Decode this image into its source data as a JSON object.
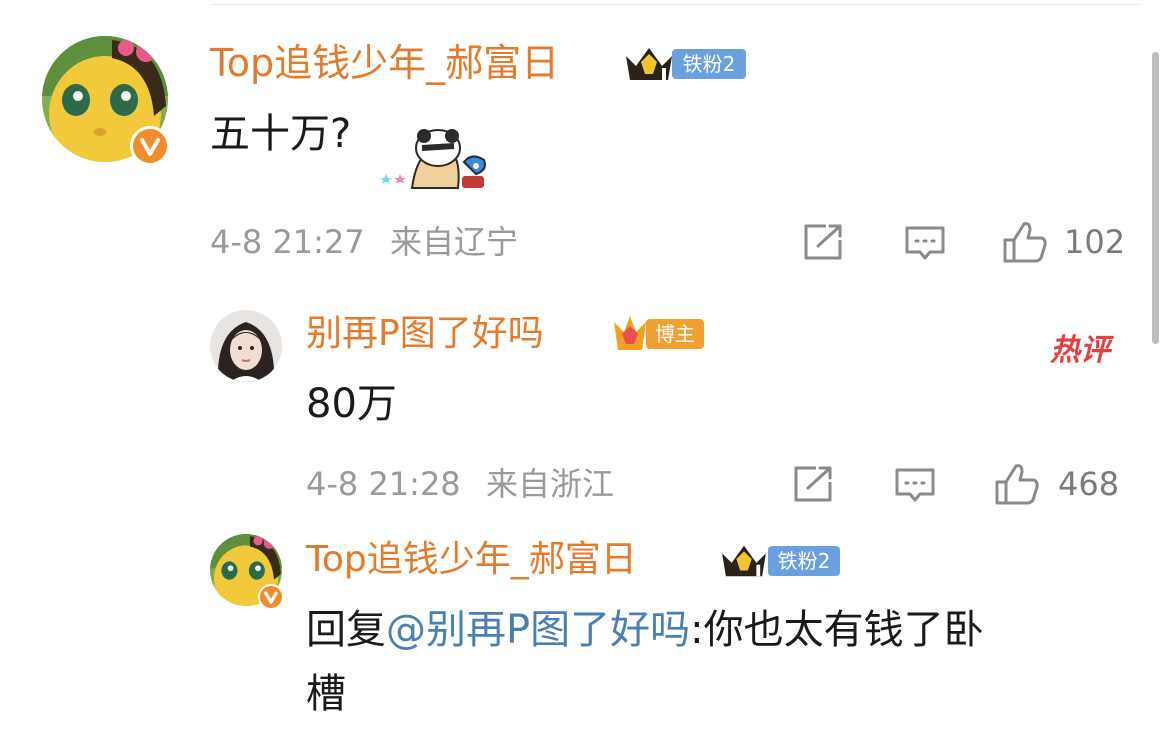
{
  "comment": {
    "username": "Top追钱少年_郝富日",
    "fan_badge": "铁粉2",
    "text": "五十万?",
    "time": "4-8 21:27",
    "location": "来自辽宁",
    "likes": "102",
    "sticker_icon": "panda-sticker-icon"
  },
  "reply_1": {
    "username": "别再P图了好吗",
    "badge": "博主",
    "hot_tag": "热评",
    "text": "80万",
    "time": "4-8 21:28",
    "location": "来自浙江",
    "likes": "468"
  },
  "reply_2": {
    "username": "Top追钱少年_郝富日",
    "fan_badge": "铁粉2",
    "reply_prefix": "回复",
    "mention": "@别再P图了好吗",
    "text_line1": ":你也太有钱了卧",
    "text_line2": "槽"
  },
  "icons": {
    "share": "share-icon",
    "comment": "comment-icon",
    "like": "thumbs-up-icon",
    "verified": "verified-v-icon",
    "crown": "crown-icon"
  },
  "colors": {
    "username": "#e57a2a",
    "fan_badge_bg": "#6aa0dd",
    "blogger_badge_bg": "#f0a030",
    "mention": "#4a7fb3",
    "hot_tag": "#e54040",
    "meta": "#9a9a9a"
  }
}
